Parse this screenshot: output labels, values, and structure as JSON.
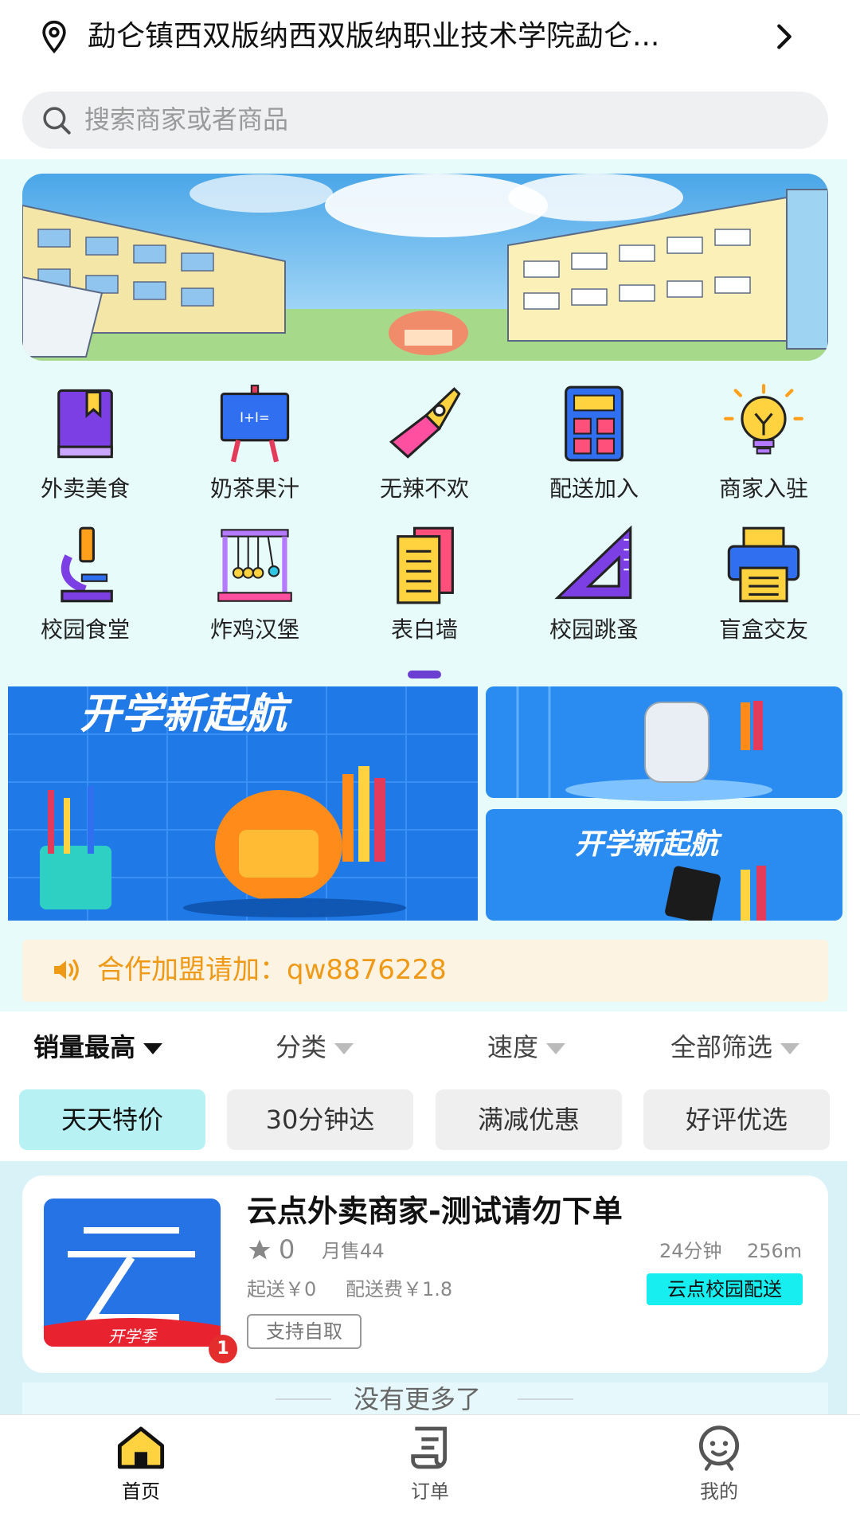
{
  "header": {
    "location": "勐仑镇西双版纳西双版纳职业技术学院勐仑...",
    "location_icon": "location-pin-icon",
    "arrow_icon": "chevron-right-icon"
  },
  "search": {
    "placeholder": "搜索商家或者商品"
  },
  "categories": [
    {
      "label": "外卖美食",
      "icon": "book-icon"
    },
    {
      "label": "奶茶果汁",
      "icon": "easel-icon"
    },
    {
      "label": "无辣不欢",
      "icon": "pen-nib-icon"
    },
    {
      "label": "配送加入",
      "icon": "calculator-icon"
    },
    {
      "label": "商家入驻",
      "icon": "light-bulb-icon"
    },
    {
      "label": "校园食堂",
      "icon": "microscope-icon"
    },
    {
      "label": "炸鸡汉堡",
      "icon": "newtons-cradle-icon"
    },
    {
      "label": "表白墙",
      "icon": "notes-icon"
    },
    {
      "label": "校园跳蚤",
      "icon": "set-square-icon"
    },
    {
      "label": "盲盒交友",
      "icon": "printer-icon"
    }
  ],
  "promo": {
    "main_text": "开学新起航",
    "side_text": "开学新起航"
  },
  "notice": {
    "text": "合作加盟请加：qw8876228"
  },
  "sort": {
    "items": [
      "销量最高",
      "分类",
      "速度",
      "全部筛选"
    ],
    "chips": [
      "天天特价",
      "30分钟达",
      "满减优惠",
      "好评优选"
    ]
  },
  "shop": {
    "name": "云点外卖商家-测试请勿下单",
    "rating": "0",
    "sales": "月售44",
    "time": "24分钟",
    "distance": "256m",
    "min_order": "起送￥0",
    "delivery_fee": "配送费￥1.8",
    "service_tag": "云点校园配送",
    "pickup_tag": "支持自取",
    "badge": "1",
    "logo_text": "开学季"
  },
  "list_end": "没有更多了",
  "tabbar": [
    {
      "label": "首页",
      "icon": "home-icon"
    },
    {
      "label": "订单",
      "icon": "order-icon"
    },
    {
      "label": "我的",
      "icon": "profile-icon"
    }
  ],
  "colors": {
    "accent": "#16eef0",
    "chip_active": "#b7f1f3",
    "notice_text": "#ef9a17",
    "indicator": "#6a3fd1",
    "badge": "#e42d2d"
  }
}
